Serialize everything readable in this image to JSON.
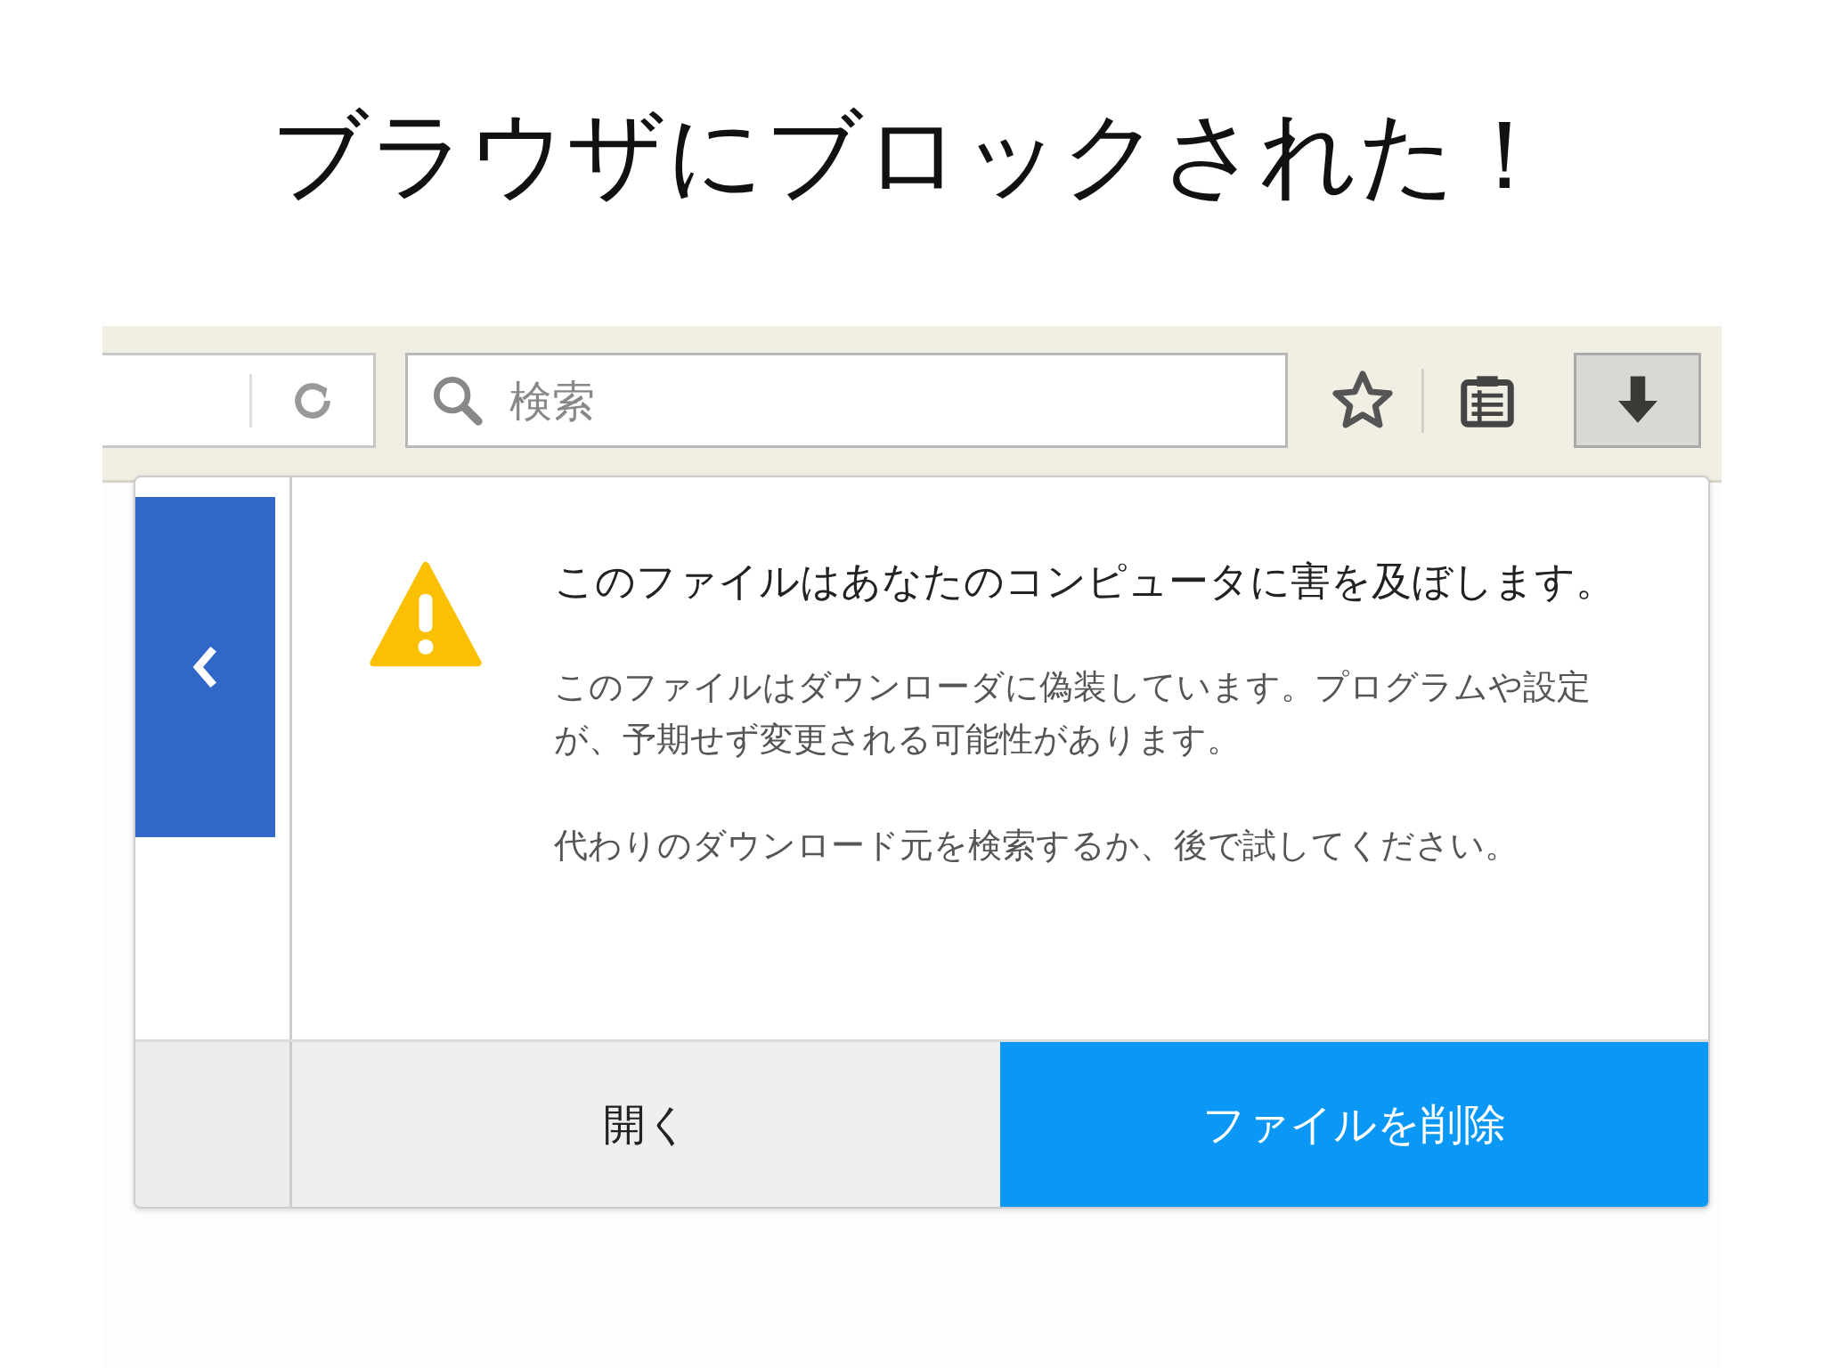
{
  "slide_title": "ブラウザにブロックされた！",
  "toolbar": {
    "search": {
      "placeholder": "検索"
    },
    "download_button": {
      "pressed": true
    }
  },
  "panel": {
    "heading": "このファイルはあなたのコンピュータに害を及ぼします。",
    "paragraphs": [
      "このファイルはダウンローダに偽装しています。プログラムや設定が、予期せず変更される可能性があります。",
      "代わりのダウンロード元を検索するか、後で試してください。"
    ],
    "buttons": [
      {
        "label": "開く",
        "kind": "secondary"
      },
      {
        "label": "ファイルを削除",
        "kind": "primary"
      }
    ]
  }
}
